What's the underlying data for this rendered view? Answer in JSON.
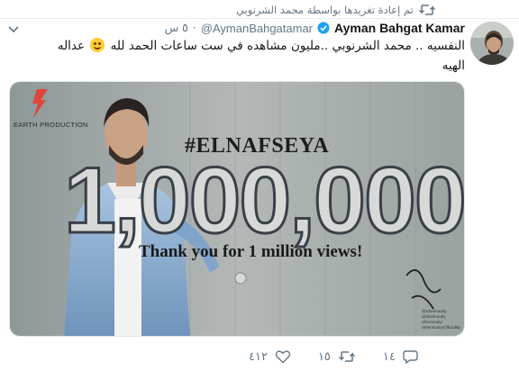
{
  "retweet": {
    "text": "تم إعادة تغريدها بواسطة محمد الشرنوبي",
    "icon": "retweet-icon"
  },
  "tweet": {
    "author_name": "Ayman Bahgat Kamar",
    "verified": true,
    "handle": "@AymanBahgatamar",
    "separator": "·",
    "time": "٥ س",
    "text_parts": [
      "النفسيه .. محمد الشرنوبي ..مليون مشاهده في ست ساعات الحمد لله",
      "عداله الهيه"
    ],
    "emoji": "smiling-face-emoji"
  },
  "media": {
    "hashtag": "#ELNAFSEYA",
    "big_number": "1,000,000",
    "thanks": "Thank you for 1 million views!",
    "logo_text": "EARTH PRODUCTION",
    "social_lines": [
      "@Sherinouby",
      "@sherinouby",
      "Sherinouby",
      "/SherinoubyOfficialBy"
    ],
    "colors": {
      "backdrop": "#9aa3a4",
      "shirt": "#87a9cd",
      "wall": "#b4b9b6"
    }
  },
  "actions": {
    "reply_count": "١٤",
    "retweet_count": "١٥",
    "like_count": "٤١٢",
    "accent": "#657786"
  }
}
